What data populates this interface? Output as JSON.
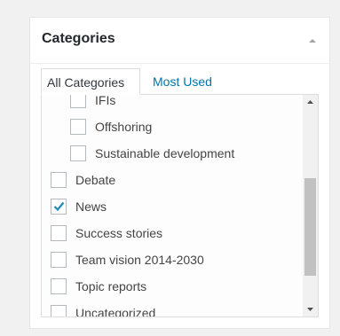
{
  "box": {
    "title": "Categories"
  },
  "tabs": [
    {
      "label": "All Categories",
      "active": true
    },
    {
      "label": "Most Used",
      "active": false
    }
  ],
  "categories": [
    {
      "label": "IFIs",
      "checked": false,
      "level": 1
    },
    {
      "label": "Offshoring",
      "checked": false,
      "level": 1
    },
    {
      "label": "Sustainable development",
      "checked": false,
      "level": 1
    },
    {
      "label": "Debate",
      "checked": false,
      "level": 0
    },
    {
      "label": "News",
      "checked": true,
      "level": 0
    },
    {
      "label": "Success stories",
      "checked": false,
      "level": 0
    },
    {
      "label": "Team vision 2014-2030",
      "checked": false,
      "level": 0
    },
    {
      "label": "Topic reports",
      "checked": false,
      "level": 0
    },
    {
      "label": "Uncategorized",
      "checked": false,
      "level": 0
    }
  ],
  "colors": {
    "link": "#0073aa",
    "checkmark": "#1e8cbe"
  }
}
